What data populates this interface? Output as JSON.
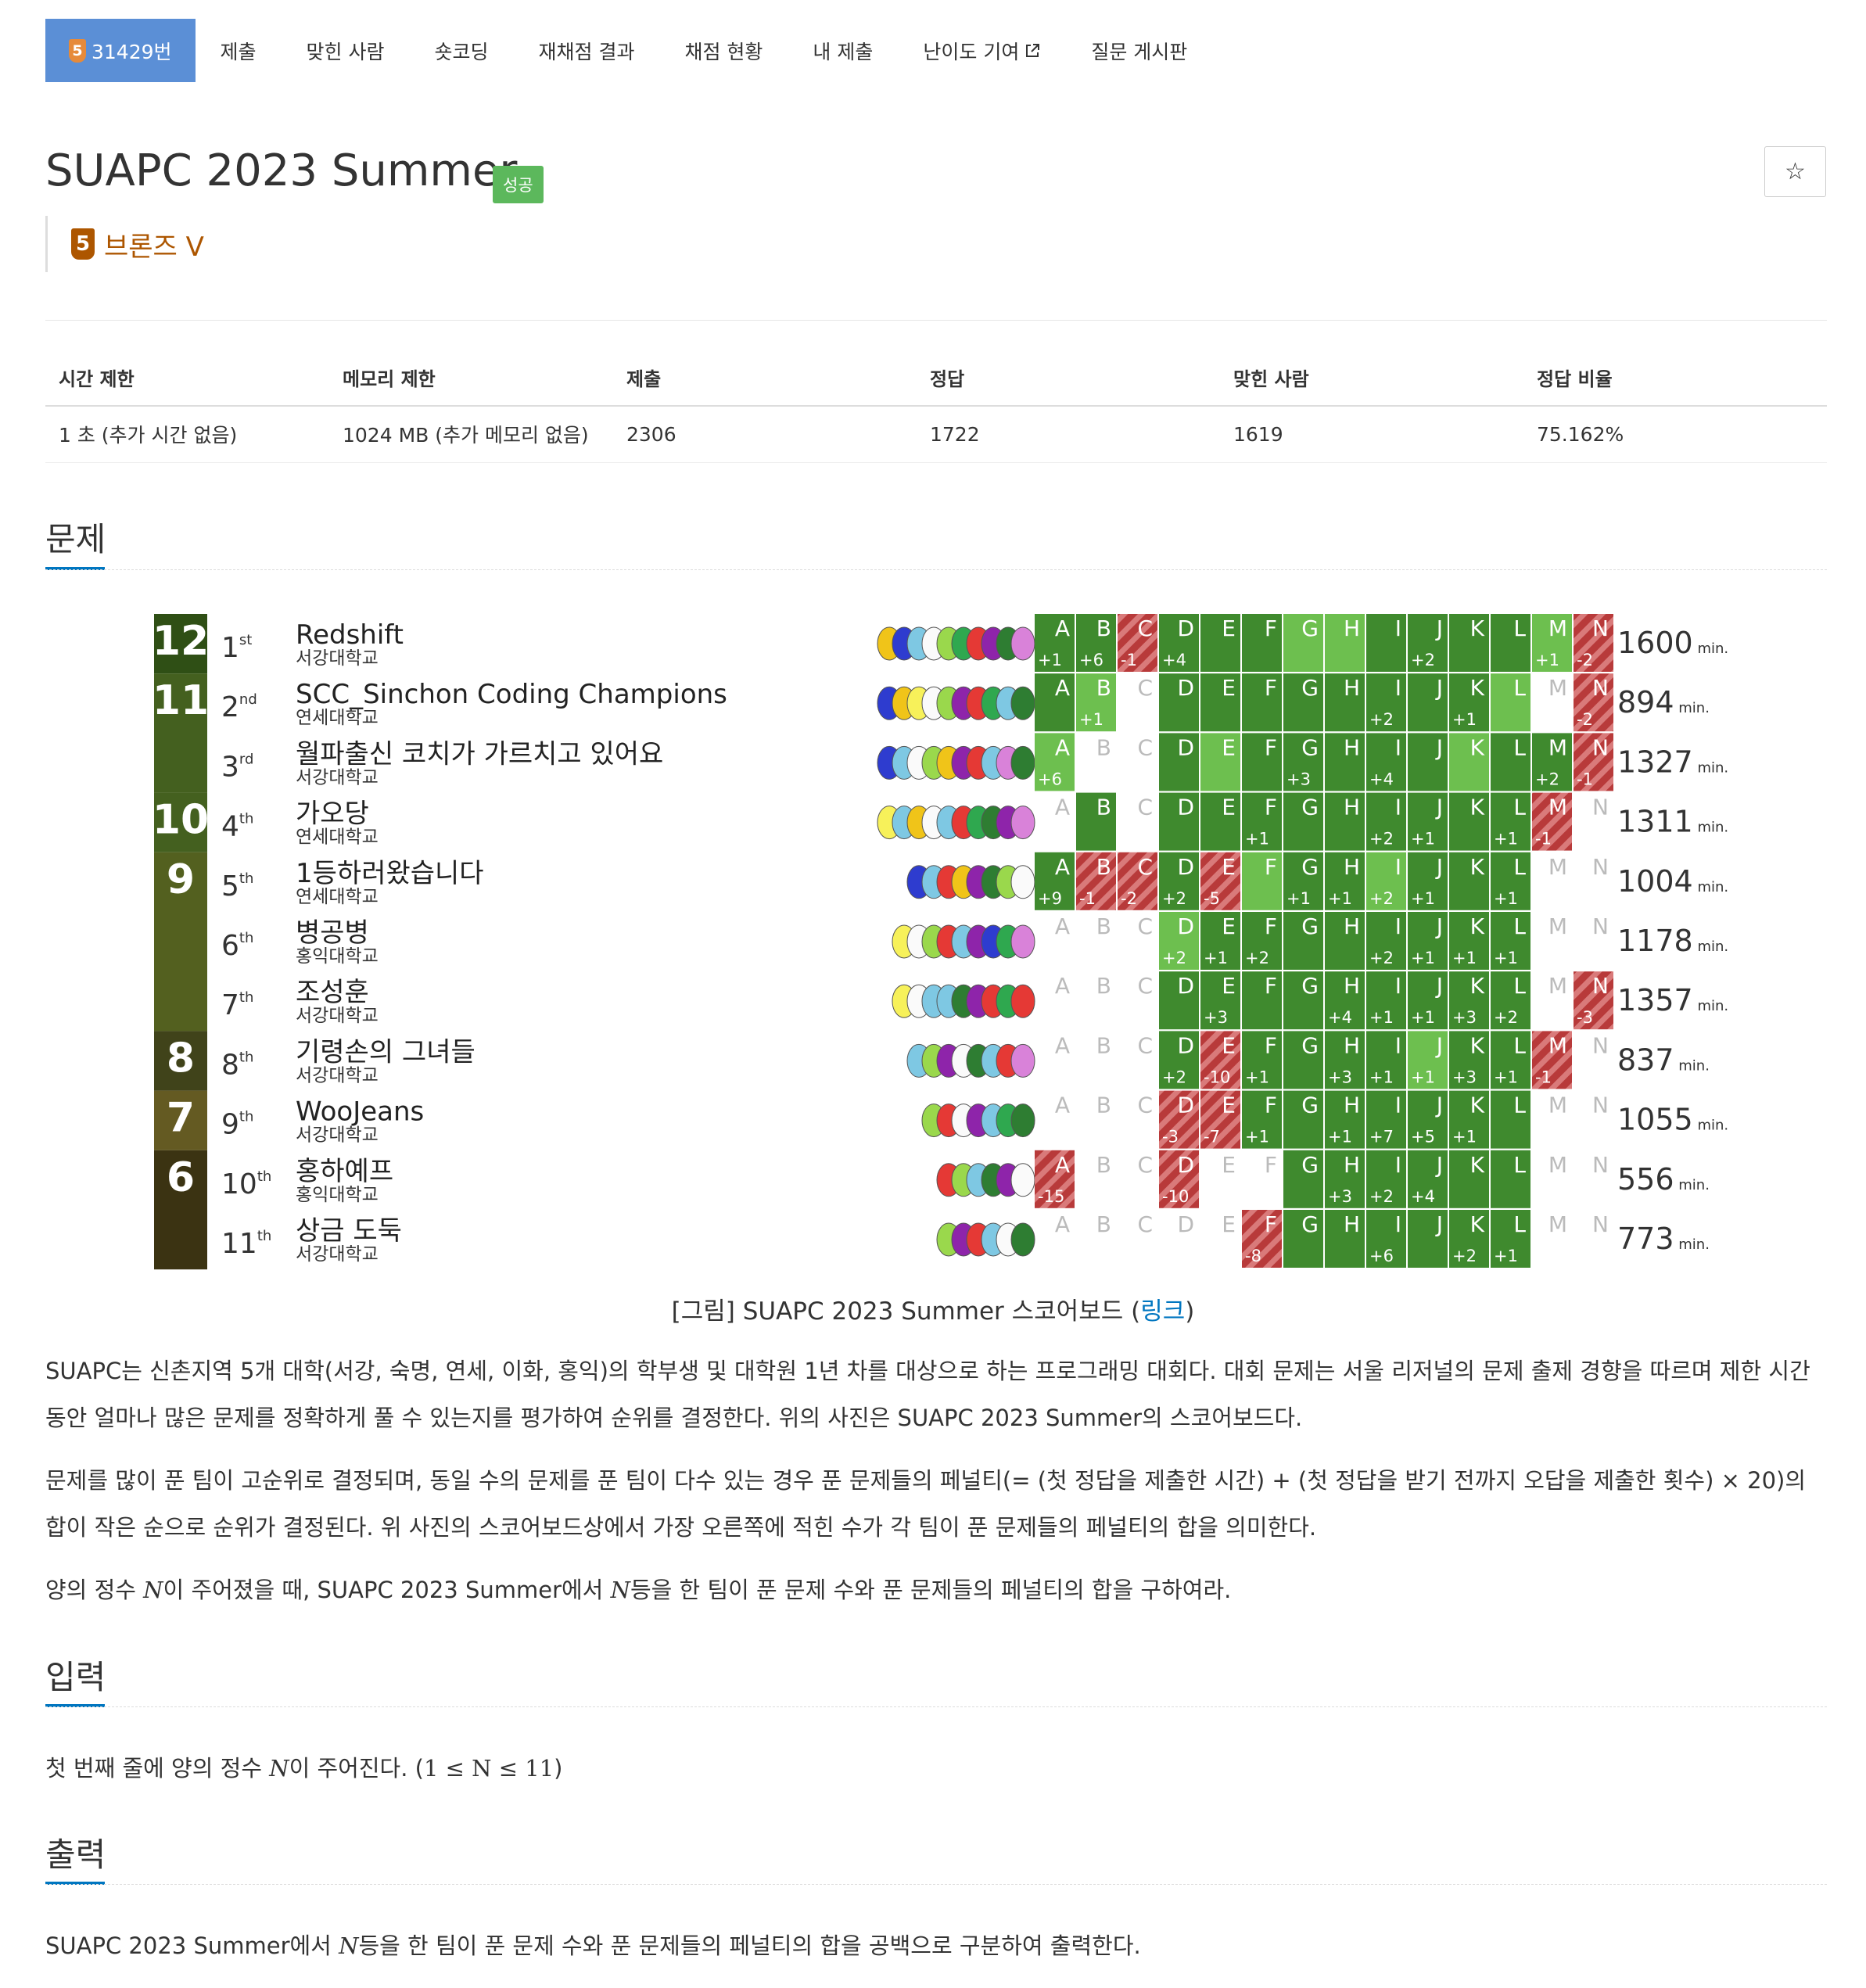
{
  "nav": {
    "problem_tab": "31429번",
    "tier_digit": "5",
    "tabs": [
      "제출",
      "맞힌 사람",
      "숏코딩",
      "재채점 결과",
      "채점 현황",
      "내 제출",
      "난이도 기여",
      "질문 게시판"
    ]
  },
  "problem": {
    "title": "SUAPC 2023 Summer",
    "badge": "성공",
    "tier_label": "브론즈 V",
    "star_icon": "☆"
  },
  "stats": {
    "headers": [
      "시간 제한",
      "메모리 제한",
      "제출",
      "정답",
      "맞힌 사람",
      "정답 비율"
    ],
    "values": [
      "1 초 (추가 시간 없음)",
      "1024 MB (추가 메모리 없음)",
      "2306",
      "1722",
      "1619",
      "75.162%"
    ]
  },
  "sections": {
    "problem": "문제",
    "input": "입력",
    "output": "출력"
  },
  "scoreboard": {
    "solve_groups": [
      {
        "count": "12",
        "color": "#2f4f15",
        "rows": 1
      },
      {
        "count": "11",
        "color": "#44601f",
        "rows": 2
      },
      {
        "count": "10",
        "color": "#44601f",
        "rows": 1
      },
      {
        "count": "9",
        "color": "#53601f",
        "rows": 3
      },
      {
        "count": "8",
        "color": "#40431a",
        "rows": 1
      },
      {
        "count": "7",
        "color": "#645a22",
        "rows": 1
      },
      {
        "count": "6",
        "color": "#3b3312",
        "rows": 2
      }
    ],
    "problem_letters": [
      "A",
      "B",
      "C",
      "D",
      "E",
      "F",
      "G",
      "H",
      "I",
      "J",
      "K",
      "L",
      "M",
      "N"
    ],
    "minutes_unit": "min.",
    "teams": [
      {
        "rank": "1",
        "suffix": "st",
        "name": "Redshift",
        "school": "서강대학교",
        "penalty": "1600",
        "balloons": [
          "#f0c419",
          "#2e3ccf",
          "#7ec8e3",
          "#fafafa",
          "#9ad84c",
          "#2fa84f",
          "#e53935",
          "#8e24aa",
          "#2e7d32",
          "#d982d9"
        ],
        "cells": [
          "A|+1",
          "A|+6",
          "W|-1",
          "A|+4",
          "A|",
          "A|",
          "F|",
          "F|",
          "A|",
          "A|+2",
          "A|",
          "A|",
          "F|+1",
          "W|-2"
        ]
      },
      {
        "rank": "2",
        "suffix": "nd",
        "name": "SCC_Sinchon Coding Champions",
        "school": "연세대학교",
        "penalty": "894",
        "balloons": [
          "#2e3ccf",
          "#f0c419",
          "#f7f15a",
          "#fafafa",
          "#9ad84c",
          "#8e24aa",
          "#e53935",
          "#2fa84f",
          "#7ec8e3",
          "#2e7d32"
        ],
        "cells": [
          "A|",
          "F|+1",
          "N|",
          "A|",
          "A|",
          "A|",
          "A|",
          "A|",
          "A|+2",
          "A|",
          "A|+1",
          "F|",
          "N|",
          "W|-2"
        ]
      },
      {
        "rank": "3",
        "suffix": "rd",
        "name": "월파출신 코치가 가르치고 있어요",
        "school": "서강대학교",
        "penalty": "1327",
        "balloons": [
          "#2e3ccf",
          "#7ec8e3",
          "#fafafa",
          "#9ad84c",
          "#f0c419",
          "#8e24aa",
          "#e53935",
          "#7ec8e3",
          "#d982d9",
          "#2e7d32"
        ],
        "cells": [
          "F|+6",
          "N|",
          "N|",
          "A|",
          "F|",
          "A|",
          "A|+3",
          "A|",
          "A|+4",
          "A|",
          "F|",
          "A|",
          "A|+2",
          "W|-1"
        ]
      },
      {
        "rank": "4",
        "suffix": "th",
        "name": "가오당",
        "school": "연세대학교",
        "penalty": "1311",
        "balloons": [
          "#f7f15a",
          "#7ec8e3",
          "#f0c419",
          "#fafafa",
          "#7ec8e3",
          "#e53935",
          "#2fa84f",
          "#2e7d32",
          "#8e24aa",
          "#d982d9"
        ],
        "cells": [
          "N|",
          "A|",
          "N|",
          "A|",
          "A|",
          "A|+1",
          "A|",
          "A|",
          "A|+2",
          "A|+1",
          "A|",
          "A|+1",
          "W|-1",
          "N|"
        ]
      },
      {
        "rank": "5",
        "suffix": "th",
        "name": "1등하러왔습니다",
        "school": "연세대학교",
        "penalty": "1004",
        "balloons": [
          "#2e3ccf",
          "#7ec8e3",
          "#e53935",
          "#f0c419",
          "#8e24aa",
          "#2e7d32",
          "#9ad84c",
          "#fafafa"
        ],
        "cells": [
          "A|+9",
          "W|-1",
          "W|-2",
          "A|+2",
          "W|-5",
          "F|",
          "A|+1",
          "A|+1",
          "F|+2",
          "A|+1",
          "A|",
          "A|+1",
          "N|",
          "N|"
        ]
      },
      {
        "rank": "6",
        "suffix": "th",
        "name": "병공병",
        "school": "홍익대학교",
        "penalty": "1178",
        "balloons": [
          "#f7f15a",
          "#fafafa",
          "#9ad84c",
          "#e53935",
          "#7ec8e3",
          "#8e24aa",
          "#2e3ccf",
          "#2fa84f",
          "#d982d9"
        ],
        "cells": [
          "N|",
          "N|",
          "N|",
          "F|+2",
          "A|+1",
          "A|+2",
          "A|",
          "A|",
          "A|+2",
          "A|+1",
          "A|+1",
          "A|+1",
          "N|",
          "N|"
        ]
      },
      {
        "rank": "7",
        "suffix": "th",
        "name": "조성훈",
        "school": "서강대학교",
        "penalty": "1357",
        "balloons": [
          "#f7f15a",
          "#fafafa",
          "#7ec8e3",
          "#7ec8e3",
          "#2e7d32",
          "#8e24aa",
          "#e53935",
          "#2fa84f",
          "#e53935"
        ],
        "cells": [
          "N|",
          "N|",
          "N|",
          "A|",
          "A|+3",
          "A|",
          "A|",
          "A|+4",
          "A|+1",
          "A|+1",
          "A|+3",
          "A|+2",
          "N|",
          "W|-3"
        ]
      },
      {
        "rank": "8",
        "suffix": "th",
        "name": "기령손의 그녀들",
        "school": "서강대학교",
        "penalty": "837",
        "balloons": [
          "#7ec8e3",
          "#9ad84c",
          "#8e24aa",
          "#fafafa",
          "#2e7d32",
          "#7ec8e3",
          "#e53935",
          "#d982d9"
        ],
        "cells": [
          "N|",
          "N|",
          "N|",
          "A|+2",
          "W|-10",
          "A|+1",
          "A|",
          "A|+3",
          "A|+1",
          "F|+1",
          "A|+3",
          "A|+1",
          "W|-1",
          "N|"
        ]
      },
      {
        "rank": "9",
        "suffix": "th",
        "name": "WooJeans",
        "school": "서강대학교",
        "penalty": "1055",
        "balloons": [
          "#9ad84c",
          "#e53935",
          "#fafafa",
          "#8e24aa",
          "#7ec8e3",
          "#2fa84f",
          "#2e7d32"
        ],
        "cells": [
          "N|",
          "N|",
          "N|",
          "W|-3",
          "W|-7",
          "A|+1",
          "A|",
          "A|+1",
          "A|+7",
          "A|+5",
          "A|+1",
          "A|",
          "N|",
          "N|"
        ]
      },
      {
        "rank": "10",
        "suffix": "th",
        "name": "홍하예프",
        "school": "홍익대학교",
        "penalty": "556",
        "balloons": [
          "#e53935",
          "#9ad84c",
          "#7ec8e3",
          "#2e7d32",
          "#8e24aa",
          "#fafafa"
        ],
        "cells": [
          "W|-15",
          "N|",
          "N|",
          "W|-10",
          "N|",
          "N|",
          "A|",
          "A|+3",
          "A|+2",
          "A|+4",
          "A|",
          "A|",
          "N|",
          "N|"
        ]
      },
      {
        "rank": "11",
        "suffix": "th",
        "name": "상금 도둑",
        "school": "서강대학교",
        "penalty": "773",
        "balloons": [
          "#9ad84c",
          "#8e24aa",
          "#e53935",
          "#7ec8e3",
          "#fafafa",
          "#2e7d32"
        ],
        "cells": [
          "N|",
          "N|",
          "N|",
          "N|",
          "N|",
          "W|-8",
          "A|",
          "A|",
          "A|+6",
          "A|",
          "A|+2",
          "A|+1",
          "N|",
          "N|"
        ]
      }
    ]
  },
  "caption": {
    "before": "[그림] SUAPC 2023 Summer 스코어보드 (",
    "link": "링크",
    "after": ")"
  },
  "text": {
    "p1": "SUAPC는 신촌지역 5개 대학(서강, 숙명, 연세, 이화, 홍익)의 학부생 및 대학원 1년 차를 대상으로 하는 프로그래밍 대회다. 대회 문제는 서울 리저널의 문제 출제 경향을 따르며 제한 시간 동안 얼마나 많은 문제를 정확하게 풀 수 있는지를 평가하여 순위를 결정한다. 위의 사진은 SUAPC 2023 Summer의 스코어보드다.",
    "p2": "문제를 많이 푼 팀이 고순위로 결정되며, 동일 수의 문제를 푼 팀이 다수 있는 경우 푼 문제들의 페널티(= (첫 정답을 제출한 시간) + (첫 정답을 받기 전까지 오답을 제출한 횟수) × 20)의 합이 작은 순으로 순위가 결정된다. 위 사진의 스코어보드상에서 가장 오른쪽에 적힌 수가 각 팀이 푼 문제들의 페널티의 합을 의미한다.",
    "p3_a": "양의 정수 ",
    "p3_n1": "N",
    "p3_b": "이 주어졌을 때, SUAPC 2023 Summer에서 ",
    "p3_n2": "N",
    "p3_c": "등을 한 팀이 푼 문제 수와 푼 문제들의 페널티의 합을 구하여라.",
    "input_a": "첫 번째 줄에 양의 정수 ",
    "input_n": "N",
    "input_b": "이 주어진다. (",
    "input_math": "1 ≤ N ≤ 11",
    "input_c": ")",
    "output_a": "SUAPC 2023 Summer에서 ",
    "output_n": "N",
    "output_b": "등을 한 팀이 푼 문제 수와 푼 문제들의 페널티의 합을 공백으로 구분하여 출력한다."
  }
}
